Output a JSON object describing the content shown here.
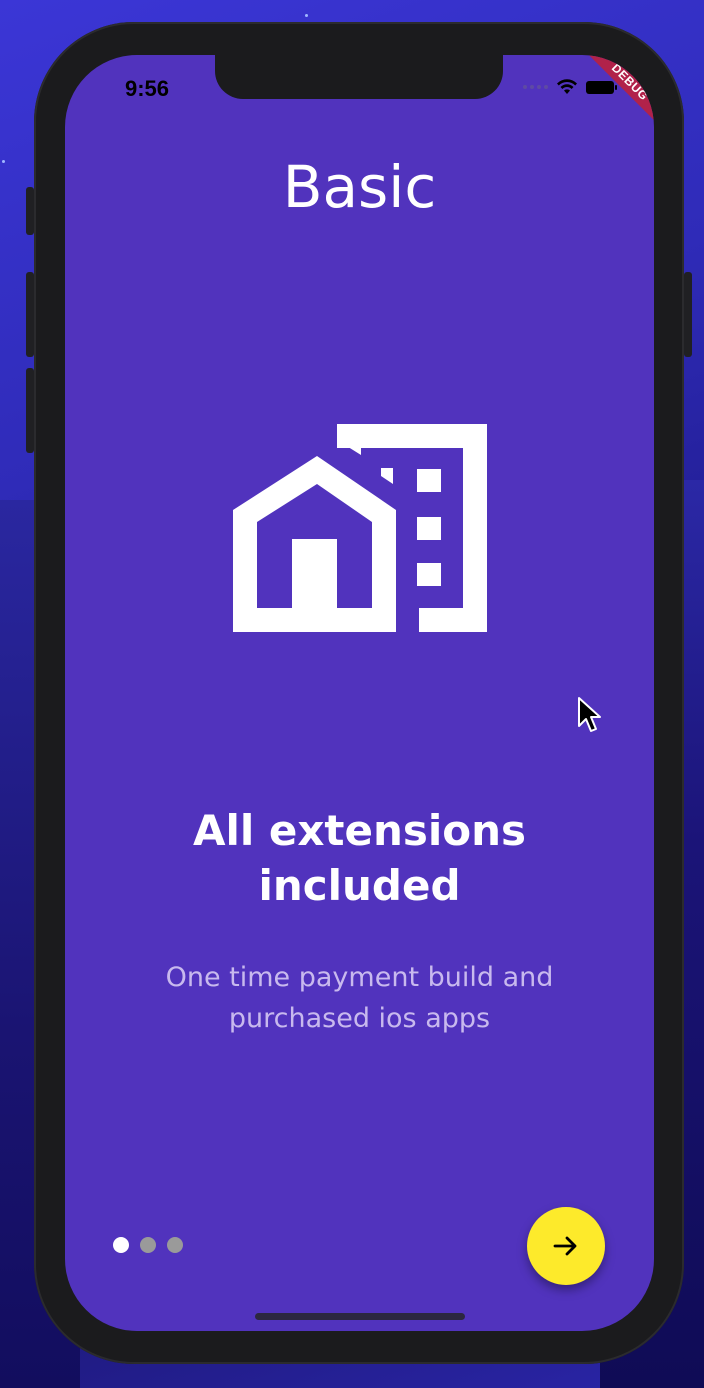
{
  "status_bar": {
    "time": "9:56",
    "debug_label": "DEBUG"
  },
  "onboarding": {
    "title": "Basic",
    "hero_icon": "house-and-building-icon",
    "headline_line1": "All extensions",
    "headline_line2": "included",
    "subtext_line1": "One time payment build and",
    "subtext_line2": "purchased ios apps"
  },
  "pager": {
    "page_count": 3,
    "current_page": 1
  },
  "next_button": {
    "icon": "arrow-right-icon",
    "color": "#fdea2b"
  },
  "colors": {
    "screen_background": "#5133bd",
    "text_primary": "#ffffff",
    "text_secondary": "#c8b9ee",
    "dot_inactive": "#9a9a9a",
    "dot_active": "#ffffff",
    "debug_banner": "#b1224a"
  }
}
